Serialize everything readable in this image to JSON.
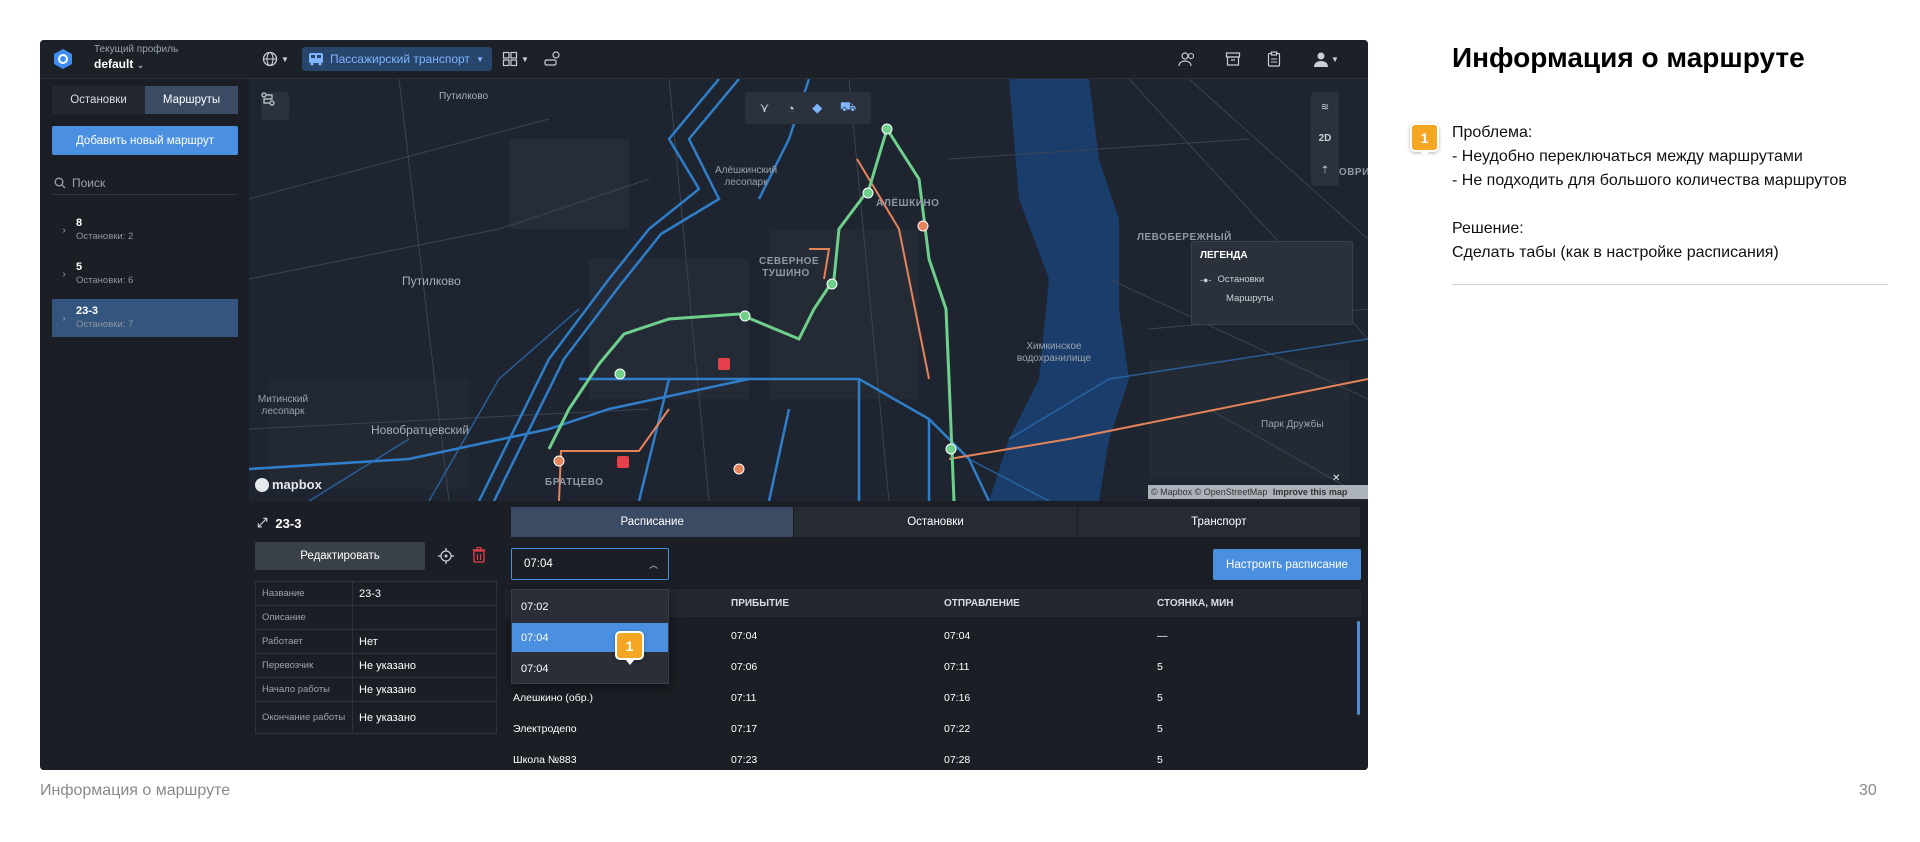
{
  "header": {
    "profile_caption": "Текущий профиль",
    "profile_name": "default",
    "transport_mode": "Пассажирский транспорт"
  },
  "sidebar": {
    "tabs": [
      "Остановки",
      "Маршруты"
    ],
    "active_tab": "Маршруты",
    "add_button": "Добавить новый маршрут",
    "search_placeholder": "Поиск",
    "routes": [
      {
        "name": "8",
        "stops": "Остановки: 2"
      },
      {
        "name": "5",
        "stops": "Остановки: 6"
      },
      {
        "name": "23-3",
        "stops": "Остановки: 7",
        "selected": true
      }
    ]
  },
  "map": {
    "labels": [
      "Путилково",
      "Путилково",
      "Алёшкинский лесопарк",
      "АЛЁШКИНО",
      "СЕВЕРНОЕ ТУШИНО",
      "ЛЕВОБЕРЕЖНЫЙ",
      "ХОВРИ",
      "Химкинское водохранилище",
      "Митинский лесопарк",
      "Новобратцевский",
      "БРАТЦЕВО",
      "Парк Дружбы"
    ],
    "legend": {
      "title": "ЛЕГЕНДА",
      "items": [
        "Остановки",
        "Маршруты"
      ]
    },
    "view_mode": "2D",
    "mapbox_logo": "mapbox",
    "attribution": "© Mapbox © OpenStreetMap",
    "attribution_link": "Improve this map",
    "colors": {
      "route": "#6fd08c",
      "roads": "#2f7ec9",
      "alt_route": "#e5835b",
      "water": "#1a3d6b"
    }
  },
  "details": {
    "route_name": "23-3",
    "edit_button": "Редактировать",
    "properties": [
      {
        "key": "Название",
        "value": "23-3"
      },
      {
        "key": "Описание",
        "value": ""
      },
      {
        "key": "Работает",
        "value": "Нет"
      },
      {
        "key": "Перевозчик",
        "value": "Не указано"
      },
      {
        "key": "Начало работы",
        "value": "Не указано"
      },
      {
        "key": "Окончание работы",
        "value": "Не указано"
      }
    ],
    "tabs": [
      "Расписание",
      "Остановки",
      "Транспорт"
    ],
    "active_tab": "Расписание",
    "time_select": "07:04",
    "dropdown_options": [
      "07:02",
      "07:04",
      "07:04"
    ],
    "dropdown_selected_index": 1,
    "schedule_button": "Настроить расписание",
    "columns": [
      "ПРИБЫТИЕ",
      "ОТПРАВЛЕНИЕ",
      "СТОЯНКА, МИН"
    ],
    "rows": [
      {
        "stop": "",
        "arrival": "07:04",
        "departure": "07:04",
        "stay": "—"
      },
      {
        "stop": "",
        "arrival": "07:06",
        "departure": "07:11",
        "stay": "5"
      },
      {
        "stop": "Алешкино (обр.)",
        "arrival": "07:11",
        "departure": "07:16",
        "stay": "5"
      },
      {
        "stop": "Электродепо",
        "arrival": "07:17",
        "departure": "07:22",
        "stay": "5"
      },
      {
        "stop": "Школа №883",
        "arrival": "07:23",
        "departure": "07:28",
        "stay": "5"
      }
    ]
  },
  "slide": {
    "title": "Информация о маршруте",
    "marker": "1",
    "problem_heading": "Проблема:",
    "problem_lines": [
      "- Неудобно переключаться между маршрутами",
      "- Не подходить для большого количества маршрутов"
    ],
    "solution_heading": "Решение:",
    "solution_line": "Сделать табы (как в настройке расписания)",
    "footer_title": "Информация о маршруте",
    "page_number": "30"
  }
}
